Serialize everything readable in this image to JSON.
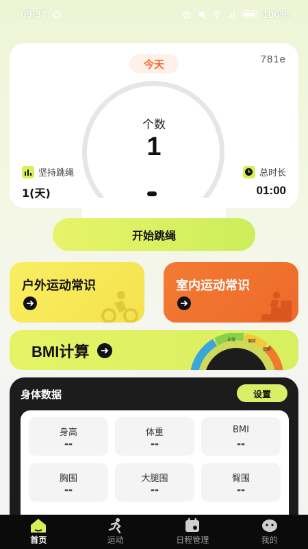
{
  "status_bar": {
    "time": "09:37",
    "battery": "100%"
  },
  "main_card": {
    "today_label": "今天",
    "device_id": "781e",
    "count_label": "个数",
    "count_value": "1",
    "left_stat": {
      "label": "坚持跳绳",
      "value": "1(天)",
      "icon": "bar-chart-icon"
    },
    "right_stat": {
      "label": "总时长",
      "value": "01:00",
      "icon": "clock-icon"
    }
  },
  "start_button": {
    "label": "开始跳绳"
  },
  "knowledge": {
    "outdoor": {
      "title": "户外运动常识",
      "icon": "cyclist-icon"
    },
    "indoor": {
      "title": "室内运动常识",
      "icon": "stairs-runner-icon"
    }
  },
  "bmi_banner": {
    "title": "BMI计算",
    "gauge_labels": [
      "正常",
      "偏胖",
      "肥胖"
    ]
  },
  "body_data": {
    "title": "身体数据",
    "settings_label": "设置",
    "cells": [
      {
        "label": "身高",
        "value": "--"
      },
      {
        "label": "体重",
        "value": "--"
      },
      {
        "label": "BMI",
        "value": "--"
      },
      {
        "label": "胸围",
        "value": "--"
      },
      {
        "label": "大腿围",
        "value": "--"
      },
      {
        "label": "臀围",
        "value": "--"
      }
    ]
  },
  "nav": {
    "items": [
      {
        "label": "首页",
        "icon": "home-icon",
        "active": true
      },
      {
        "label": "运动",
        "icon": "runner-icon",
        "active": false
      },
      {
        "label": "日程管理",
        "icon": "calendar-icon",
        "active": false
      },
      {
        "label": "我的",
        "icon": "profile-icon",
        "active": false
      }
    ]
  },
  "colors": {
    "accent_lime": "#d9ef56",
    "accent_orange": "#ee6a2a",
    "accent_yellow": "#f6e85a",
    "dark_panel": "#1c1c1c"
  }
}
